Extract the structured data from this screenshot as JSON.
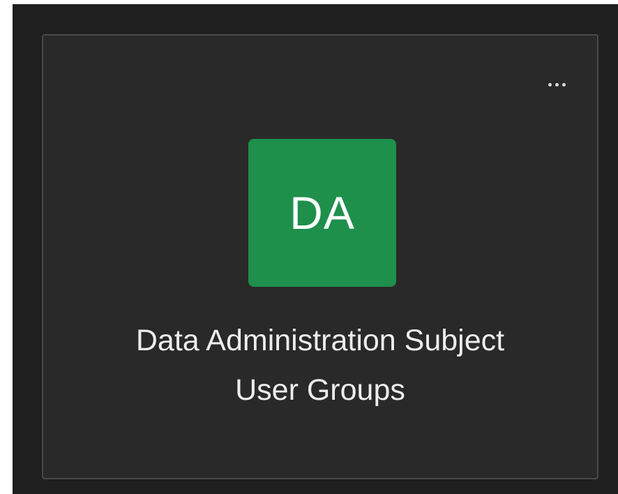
{
  "team_card": {
    "initials": "DA",
    "name_line_1": "Data Administration Subject",
    "name_line_2": "User Groups",
    "more_options_icon": "more-options-icon",
    "avatar_color": "#1f8f4c",
    "background_color": "#292929"
  }
}
